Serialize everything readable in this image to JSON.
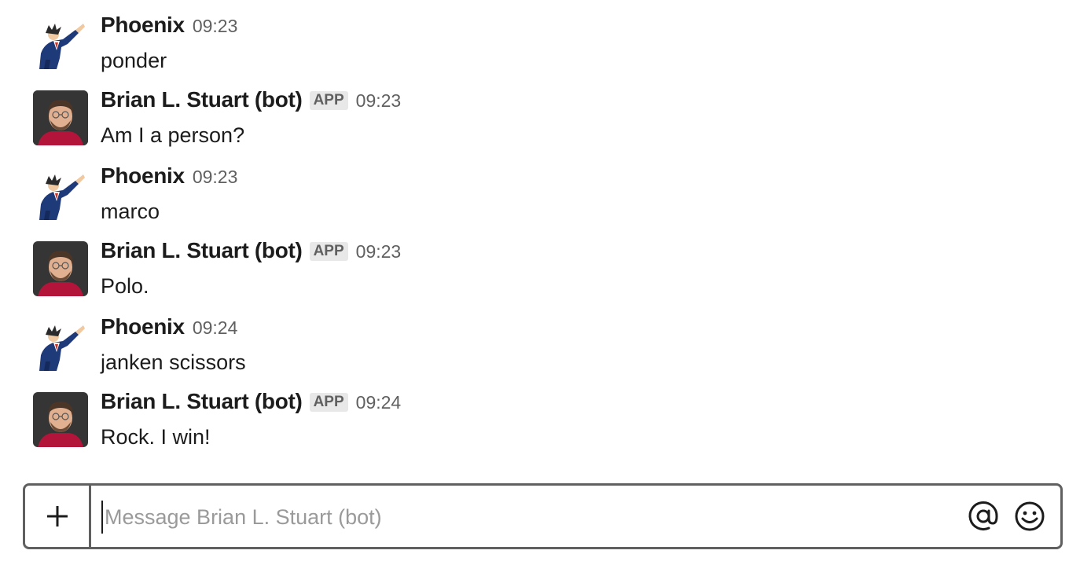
{
  "messages": [
    {
      "sender": "Phoenix",
      "badge": "",
      "time": "09:23",
      "text": "ponder",
      "avatar": "phoenix-avatar"
    },
    {
      "sender": "Brian L. Stuart (bot)",
      "badge": "APP",
      "time": "09:23",
      "text": "Am I a person?",
      "avatar": "brian-avatar"
    },
    {
      "sender": "Phoenix",
      "badge": "",
      "time": "09:23",
      "text": "marco",
      "avatar": "phoenix-avatar"
    },
    {
      "sender": "Brian L. Stuart (bot)",
      "badge": "APP",
      "time": "09:23",
      "text": "Polo.",
      "avatar": "brian-avatar"
    },
    {
      "sender": "Phoenix",
      "badge": "",
      "time": "09:24",
      "text": "janken scissors",
      "avatar": "phoenix-avatar"
    },
    {
      "sender": "Brian L. Stuart (bot)",
      "badge": "APP",
      "time": "09:24",
      "text": "Rock. I win!",
      "avatar": "brian-avatar"
    }
  ],
  "composer": {
    "placeholder": "Message Brian L. Stuart (bot)",
    "value": "",
    "attach_icon": "plus-icon",
    "mention_icon": "at-sign-icon",
    "emoji_icon": "smiley-icon"
  },
  "colors": {
    "text": "#1d1c1d",
    "muted": "#616061",
    "badge_bg": "#e8e8e8",
    "border": "#616061",
    "placeholder": "#9a9a9a"
  }
}
